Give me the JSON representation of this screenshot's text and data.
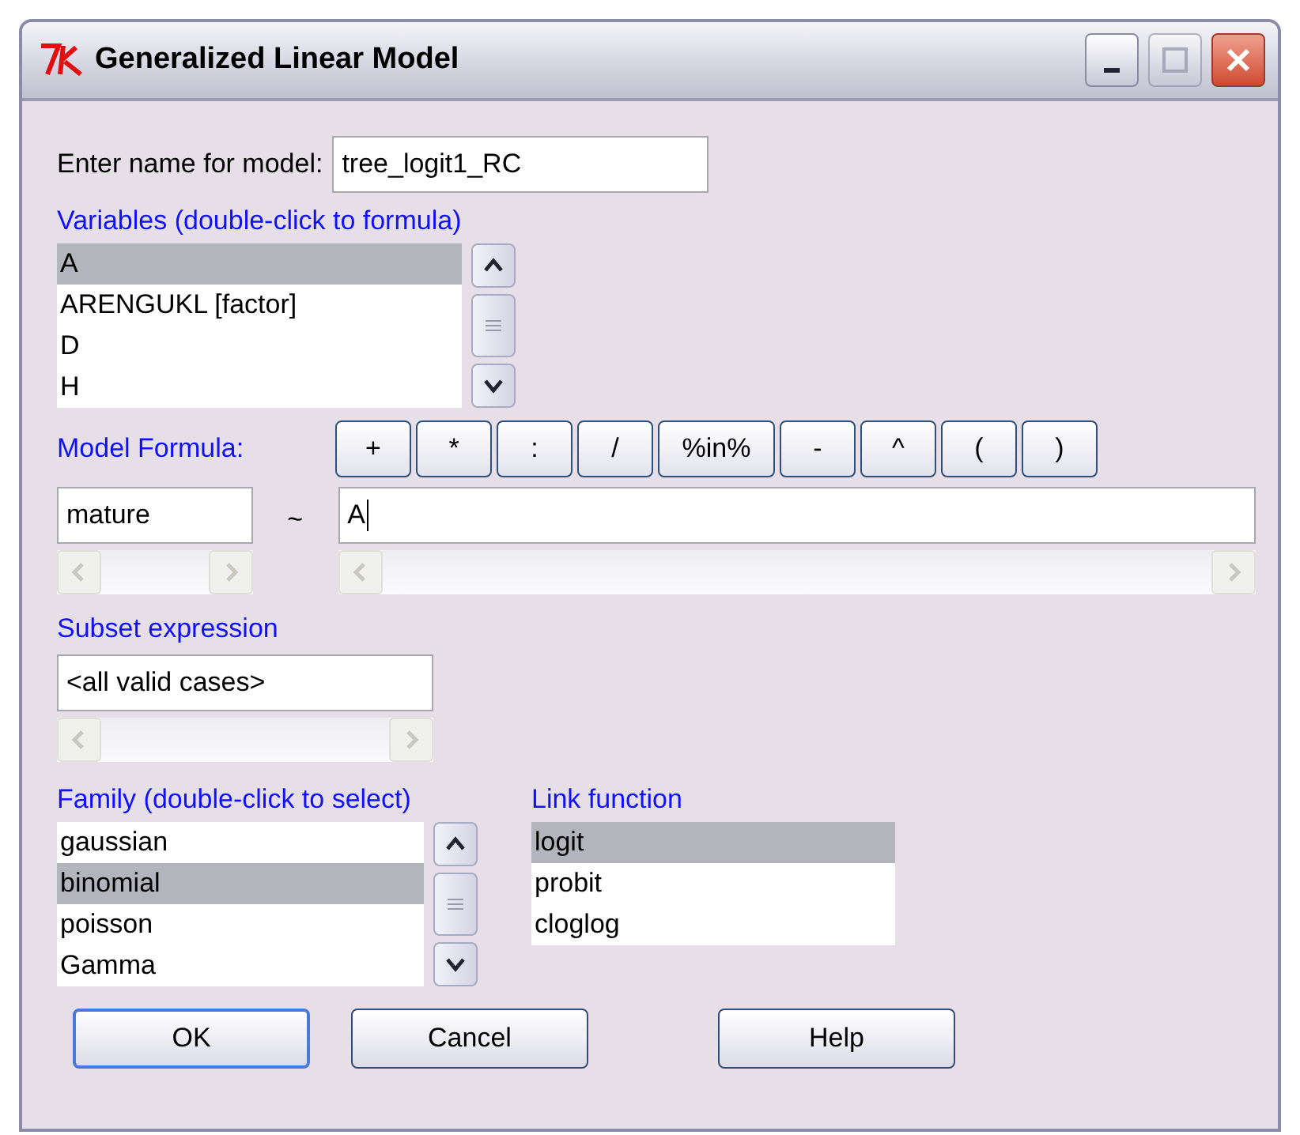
{
  "window": {
    "title": "Generalized Linear Model"
  },
  "model_name": {
    "label": "Enter name for model:",
    "value": "tree_logit1_RC"
  },
  "variables": {
    "label": "Variables (double-click to formula)",
    "items": [
      {
        "text": "A",
        "selected": true
      },
      {
        "text": "ARENGUKL [factor]",
        "selected": false
      },
      {
        "text": "D",
        "selected": false
      },
      {
        "text": "H",
        "selected": false
      }
    ]
  },
  "formula": {
    "label": "Model Formula:",
    "operators": [
      "+",
      "*",
      ":",
      "/",
      "%in%",
      "-",
      "^",
      "(",
      ")"
    ],
    "response": "mature",
    "tilde": "~",
    "rhs": "A"
  },
  "subset": {
    "label": "Subset expression",
    "value": "<all valid cases>"
  },
  "family": {
    "label": "Family (double-click to select)",
    "items": [
      {
        "text": "gaussian",
        "selected": false
      },
      {
        "text": "binomial",
        "selected": true
      },
      {
        "text": "poisson",
        "selected": false
      },
      {
        "text": "Gamma",
        "selected": false
      }
    ]
  },
  "link": {
    "label": "Link function",
    "items": [
      {
        "text": "logit",
        "selected": true
      },
      {
        "text": "probit",
        "selected": false
      },
      {
        "text": "cloglog",
        "selected": false
      }
    ]
  },
  "buttons": [
    {
      "label": "OK",
      "default": true
    },
    {
      "label": "Cancel",
      "default": false
    },
    {
      "label": "Help",
      "default": false
    }
  ]
}
